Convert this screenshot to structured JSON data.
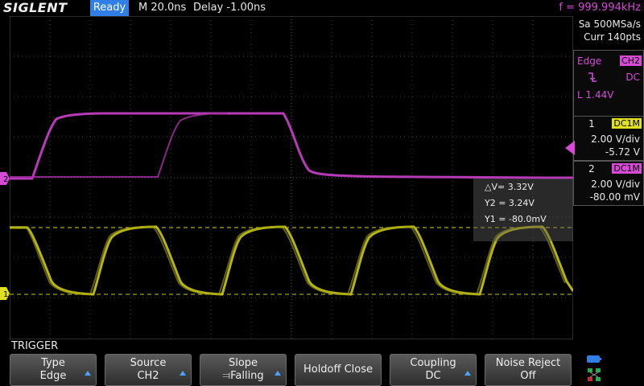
{
  "header": {
    "logo": "SIGLENT",
    "status": "Ready",
    "timebase": "M 20.0ns",
    "delay": "Delay -1.00ns",
    "frequency": "f = 999.994kHz"
  },
  "acquisition": {
    "sample_rate": "Sa 500MSa/s",
    "current_points": "Curr 140pts"
  },
  "trigger_panel": {
    "type": "Edge",
    "source": "CH2",
    "coupling": "DC",
    "level": "L  1.44V",
    "slope_icon": "falling-edge-icon"
  },
  "channels": [
    {
      "number": "1",
      "coupling": "DC1M",
      "vdiv": "2.00 V/div",
      "offset": "-5.72 V",
      "color": "#e0e020"
    },
    {
      "number": "2",
      "coupling": "DC1M",
      "vdiv": "2.00 V/div",
      "offset": "-80.00 mV",
      "color": "#d64ad6"
    }
  ],
  "cursors": {
    "delta_v": "△V= 3.32V",
    "y2": "Y2 = 3.24V",
    "y1": "Y1 = -80.0mV"
  },
  "markers": {
    "ch1": "1",
    "ch2": "2"
  },
  "menu": {
    "title": "TRIGGER",
    "softkeys": [
      {
        "top": "Type",
        "bottom": "Edge",
        "arrow": true
      },
      {
        "top": "Source",
        "bottom": "CH2",
        "arrow": true
      },
      {
        "top": "Slope",
        "bottom": "⫤Falling",
        "arrow": true
      },
      {
        "single": "Holdoff Close",
        "arrow": false
      },
      {
        "top": "Coupling",
        "bottom": "DC",
        "arrow": true
      },
      {
        "top": "Noise Reject",
        "bottom": "Off",
        "arrow": false
      }
    ]
  },
  "colors": {
    "ch1": "#e0e020",
    "ch2": "#d64ad6",
    "accent": "#2f7fe6"
  }
}
